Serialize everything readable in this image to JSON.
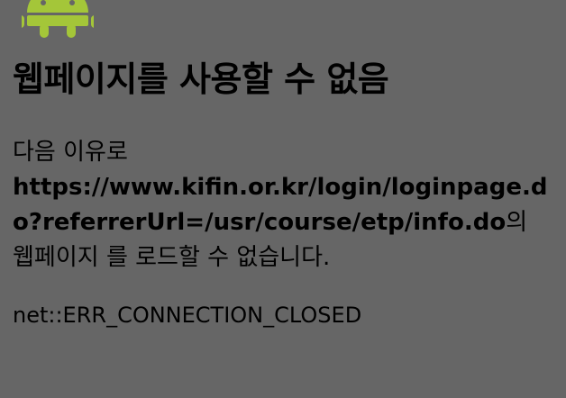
{
  "logo": {
    "icon": "android-robot-icon",
    "color": "#A4C639"
  },
  "title": "웹페이지를 사용할 수 없음",
  "message": {
    "prefix": "다음 이유로",
    "url": "https://www.kifin.or.kr/login/loginpage.do?referrerUrl=/usr/course/etp/info.do",
    "suffix_1": "의 웹페이지",
    "suffix_2": "를 로드할 수 없습니다."
  },
  "error_code": "net::ERR_CONNECTION_CLOSED"
}
